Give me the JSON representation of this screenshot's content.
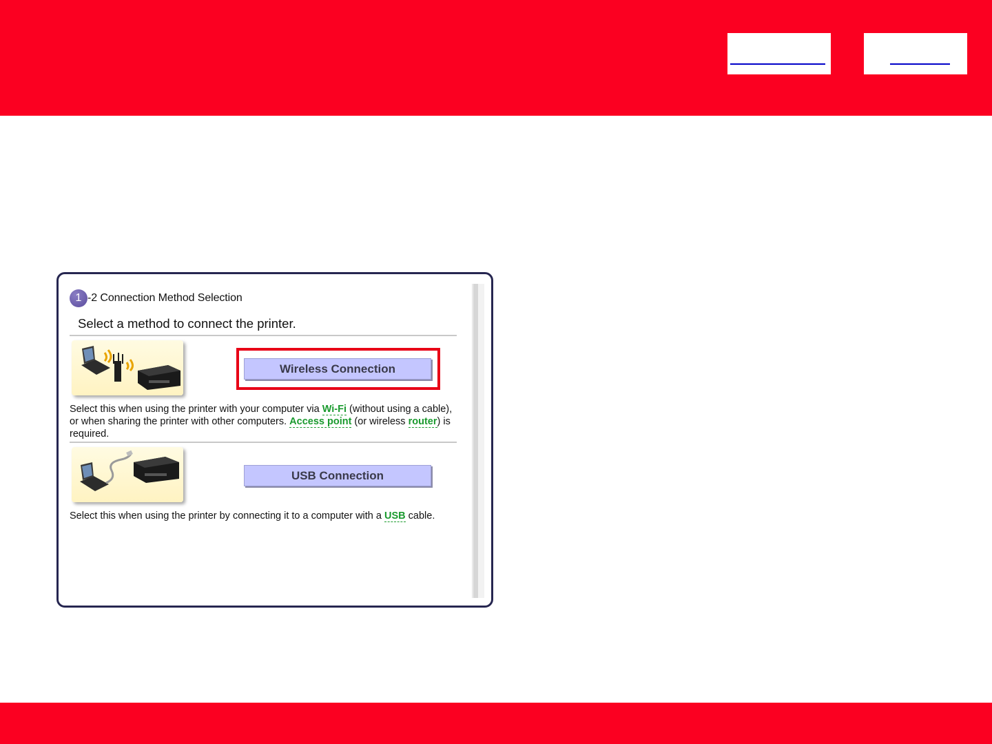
{
  "header": {
    "nav_link_1": "",
    "nav_link_2": ""
  },
  "panel": {
    "step_number": "1",
    "step_title": "-2 Connection Method Selection",
    "instruction": "Select a method to connect the printer.",
    "wireless": {
      "button_label": "Wireless Connection",
      "desc_part1": "Select this when using the printer with your computer via ",
      "term_wifi": "Wi-Fi",
      "desc_part2": " (without using a cable), or when sharing the printer with other computers. ",
      "term_access_point": "Access point",
      "desc_part3": " (or wireless ",
      "term_router": "router",
      "desc_part4": ") is required."
    },
    "usb": {
      "button_label": "USB Connection",
      "desc_part1": "Select this when using the printer by connecting it to a computer with a ",
      "term_usb": "USB",
      "desc_part2": " cable."
    }
  },
  "colors": {
    "brand_red": "#fb0021",
    "highlight_red": "#e80016",
    "button_fill": "#c4c6ff",
    "term_green": "#1a9a2e",
    "step_badge_purple": "#5b4c9e"
  },
  "icons": {
    "wireless_thumbnail": "laptop-router-printer-wireless-illustration",
    "usb_thumbnail": "laptop-usb-cable-printer-illustration"
  }
}
